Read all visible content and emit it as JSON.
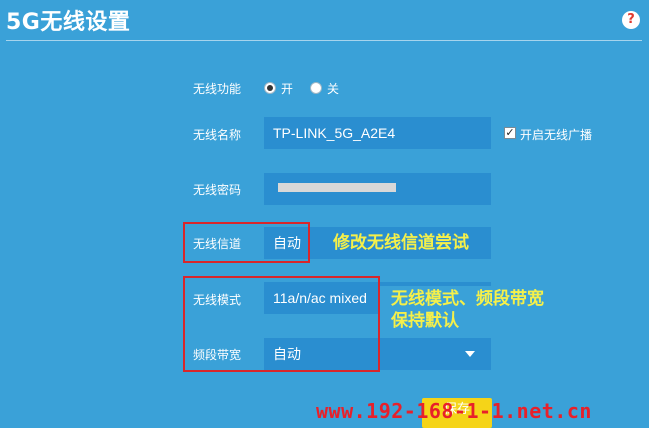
{
  "page": {
    "title": "5G无线设置",
    "help_icon": "?"
  },
  "wireless_function": {
    "label": "无线功能",
    "options": [
      {
        "label": "开",
        "checked": true
      },
      {
        "label": "关",
        "checked": false
      }
    ]
  },
  "wireless_name": {
    "label": "无线名称",
    "value": "TP-LINK_5G_A2E4",
    "broadcast_checkbox": {
      "label": "开启无线广播",
      "checked": true
    }
  },
  "wireless_password": {
    "label": "无线密码",
    "masked": true
  },
  "wireless_channel": {
    "label": "无线信道",
    "value": "自动"
  },
  "wireless_mode": {
    "label": "无线模式",
    "value": "11a/n/ac mixed"
  },
  "band_width": {
    "label": "频段带宽",
    "value": "自动"
  },
  "save_button": {
    "label": "保存"
  },
  "annotations": {
    "channel_note": "修改无线信道尝试",
    "mode_note_line1": "无线模式、频段带宽",
    "mode_note_line2": "保持默认"
  },
  "watermark": "www.192-168-1-1.net.cn",
  "colors": {
    "background": "#3aa1d8",
    "field": "#2a8ed0",
    "annotation_text": "#f5f04a",
    "highlight_box": "#d9262b",
    "save_button": "#f5d418",
    "watermark": "#e8202a"
  }
}
